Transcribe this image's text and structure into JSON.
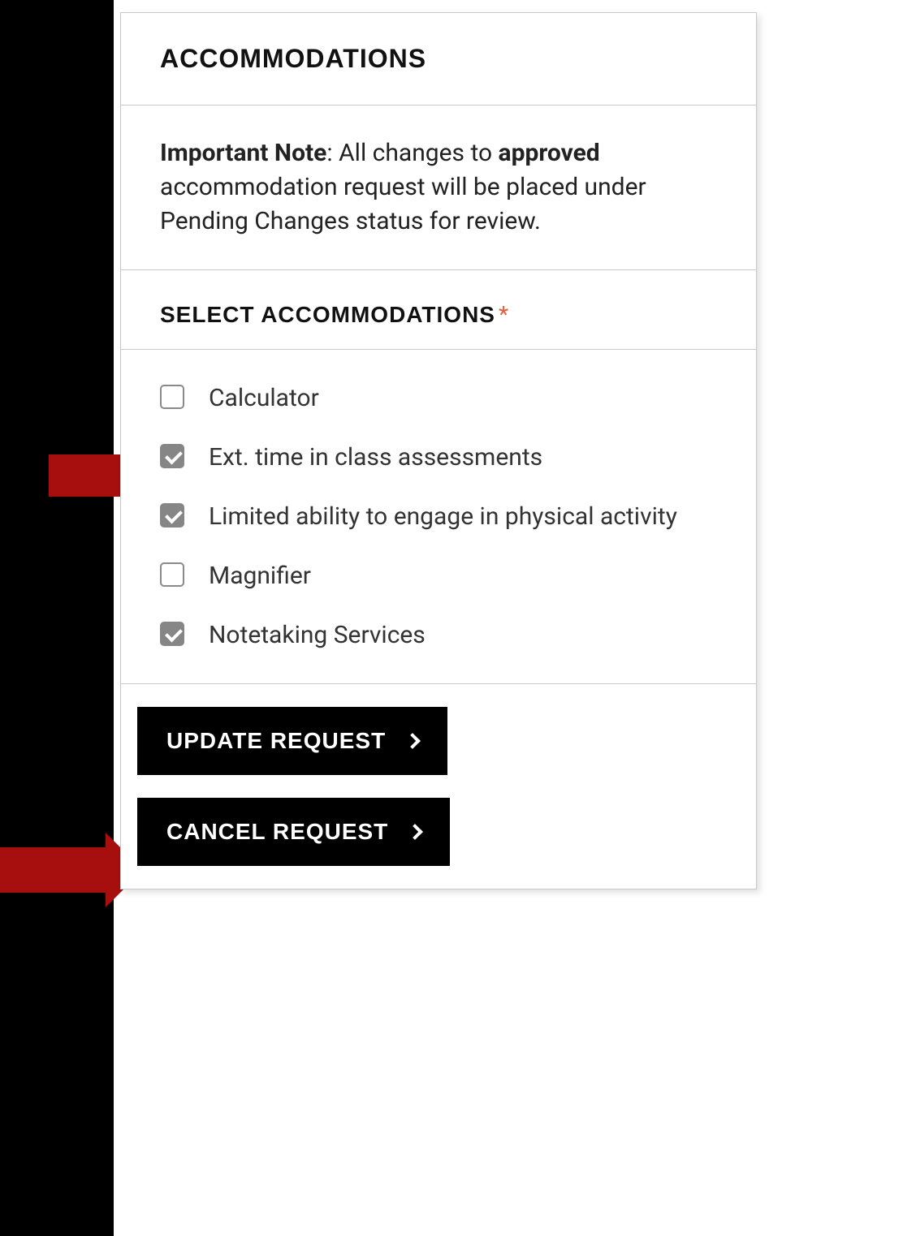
{
  "header": {
    "title": "ACCOMMODATIONS"
  },
  "note": {
    "bold_prefix": "Important Note",
    "text_1": ": All changes to ",
    "bold_word": "approved",
    "text_2": " accommodation request will be placed under Pending Changes status for review."
  },
  "select_section": {
    "title": "SELECT ACCOMMODATIONS",
    "required_marker": "*"
  },
  "accommodations": [
    {
      "label": "Calculator",
      "checked": false
    },
    {
      "label": "Ext. time in class assessments",
      "checked": true
    },
    {
      "label": "Limited ability to engage in physical activity",
      "checked": true
    },
    {
      "label": "Magnifier",
      "checked": false
    },
    {
      "label": "Notetaking Services",
      "checked": true
    }
  ],
  "buttons": {
    "update": "UPDATE REQUEST",
    "cancel": "CANCEL REQUEST"
  }
}
